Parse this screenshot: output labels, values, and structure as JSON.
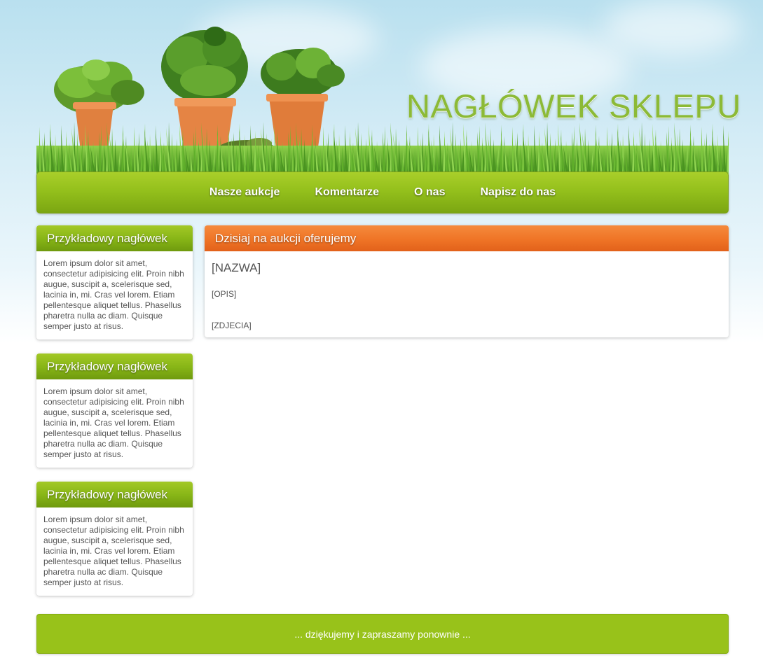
{
  "header": {
    "title": "NAGŁÓWEK SKLEPU"
  },
  "nav": {
    "items": [
      "Nasze aukcje",
      "Komentarze",
      "O nas",
      "Napisz do nas"
    ]
  },
  "sidebar": {
    "boxes": [
      {
        "title": "Przykładowy nagłówek",
        "text": "Lorem ipsum dolor sit amet, consectetur adipisicing elit. Proin nibh augue, suscipit a, scelerisque sed, lacinia in, mi. Cras vel lorem. Etiam pellentesque aliquet tellus. Phasellus pharetra nulla ac diam. Quisque semper justo at risus."
      },
      {
        "title": "Przykładowy nagłówek",
        "text": "Lorem ipsum dolor sit amet, consectetur adipisicing elit. Proin nibh augue, suscipit a, scelerisque sed, lacinia in, mi. Cras vel lorem. Etiam pellentesque aliquet tellus. Phasellus pharetra nulla ac diam. Quisque semper justo at risus."
      },
      {
        "title": "Przykładowy nagłówek",
        "text": "Lorem ipsum dolor sit amet, consectetur adipisicing elit. Proin nibh augue, suscipit a, scelerisque sed, lacinia in, mi. Cras vel lorem. Etiam pellentesque aliquet tellus. Phasellus pharetra nulla ac diam. Quisque semper justo at risus."
      }
    ]
  },
  "main": {
    "title": "Dzisiaj na aukcji oferujemy",
    "name": "[NAZWA]",
    "description": "[OPIS]",
    "photos": "[ZDJECIA]"
  },
  "footer": {
    "text": "... dziękujemy i zapraszamy ponownie ..."
  },
  "colors": {
    "green_accent": "#94c01c",
    "orange_accent": "#ef7426",
    "title_green": "#8cba36"
  }
}
